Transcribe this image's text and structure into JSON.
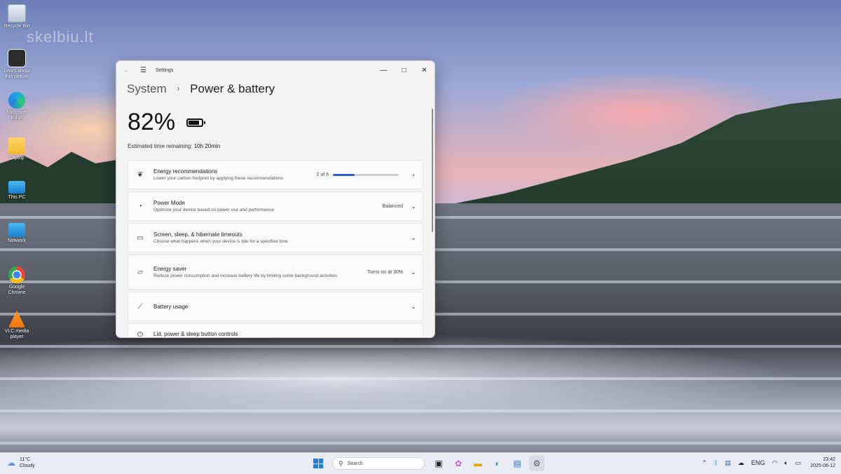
{
  "watermark": "skelbiu.lt",
  "desktop_icons": [
    {
      "label": "Recycle Bin",
      "icon": "recycle-bin-icon"
    },
    {
      "label": "Learn about this picture",
      "icon": "learn-picture-icon"
    },
    {
      "label": "Microsoft Edge",
      "icon": "edge-icon"
    },
    {
      "label": "Laptop",
      "icon": "folder-icon"
    },
    {
      "label": "This PC",
      "icon": "this-pc-icon"
    },
    {
      "label": "Network",
      "icon": "network-icon"
    },
    {
      "label": "Google Chrome",
      "icon": "chrome-icon"
    },
    {
      "label": "VLC media player",
      "icon": "vlc-icon"
    }
  ],
  "window": {
    "title": "Settings",
    "breadcrumb": {
      "parent": "System",
      "current": "Power & battery"
    },
    "battery_percent": "82%",
    "battery_level": 0.82,
    "estimated_label": "Estimated time remaining:",
    "estimated_value": "10h 20min",
    "cards": [
      {
        "title": "Energy recommendations",
        "subtitle": "Lower your carbon footprint by applying these recommendations",
        "right": "2 of 6",
        "progress": 0.33,
        "chevron": "›",
        "icon": "leaf-icon"
      },
      {
        "title": "Power Mode",
        "subtitle": "Optimize your device based on power use and performance",
        "right": "Balanced",
        "chevron": "⌄",
        "icon": "gauge-icon"
      },
      {
        "title": "Screen, sleep, & hibernate timeouts",
        "subtitle": "Choose what happens when your device is idle for a specified time",
        "right": "",
        "chevron": "⌄",
        "icon": "screen-sleep-icon"
      },
      {
        "title": "Energy saver",
        "subtitle": "Reduce power consumption and increase battery life by limiting some background activities",
        "right": "Turns on at 30%",
        "chevron": "⌄",
        "icon": "energy-saver-icon"
      },
      {
        "title": "Battery usage",
        "subtitle": "",
        "right": "",
        "chevron": "⌄",
        "icon": "chart-icon"
      },
      {
        "title": "Lid, power & sleep button controls",
        "subtitle": "",
        "right": "",
        "chevron": "",
        "icon": "power-button-icon"
      }
    ]
  },
  "taskbar": {
    "weather_temp": "11°C",
    "weather_desc": "Cloudy",
    "search_placeholder": "Search",
    "language": "ENG",
    "time": "23:42",
    "date": "2025-06-12"
  }
}
